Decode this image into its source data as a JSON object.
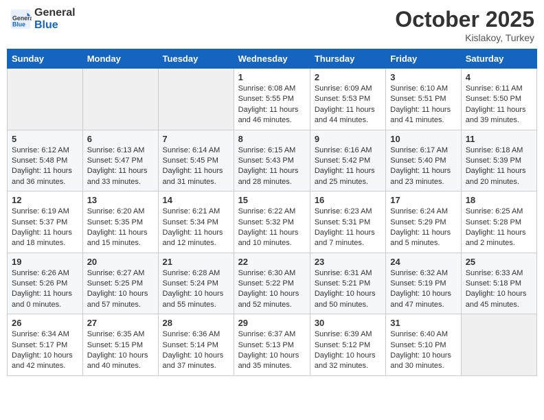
{
  "header": {
    "logo_line1": "General",
    "logo_line2": "Blue",
    "month": "October 2025",
    "location": "Kislakoy, Turkey"
  },
  "days_of_week": [
    "Sunday",
    "Monday",
    "Tuesday",
    "Wednesday",
    "Thursday",
    "Friday",
    "Saturday"
  ],
  "weeks": [
    [
      {
        "day": "",
        "info": ""
      },
      {
        "day": "",
        "info": ""
      },
      {
        "day": "",
        "info": ""
      },
      {
        "day": "1",
        "info": "Sunrise: 6:08 AM\nSunset: 5:55 PM\nDaylight: 11 hours\nand 46 minutes."
      },
      {
        "day": "2",
        "info": "Sunrise: 6:09 AM\nSunset: 5:53 PM\nDaylight: 11 hours\nand 44 minutes."
      },
      {
        "day": "3",
        "info": "Sunrise: 6:10 AM\nSunset: 5:51 PM\nDaylight: 11 hours\nand 41 minutes."
      },
      {
        "day": "4",
        "info": "Sunrise: 6:11 AM\nSunset: 5:50 PM\nDaylight: 11 hours\nand 39 minutes."
      }
    ],
    [
      {
        "day": "5",
        "info": "Sunrise: 6:12 AM\nSunset: 5:48 PM\nDaylight: 11 hours\nand 36 minutes."
      },
      {
        "day": "6",
        "info": "Sunrise: 6:13 AM\nSunset: 5:47 PM\nDaylight: 11 hours\nand 33 minutes."
      },
      {
        "day": "7",
        "info": "Sunrise: 6:14 AM\nSunset: 5:45 PM\nDaylight: 11 hours\nand 31 minutes."
      },
      {
        "day": "8",
        "info": "Sunrise: 6:15 AM\nSunset: 5:43 PM\nDaylight: 11 hours\nand 28 minutes."
      },
      {
        "day": "9",
        "info": "Sunrise: 6:16 AM\nSunset: 5:42 PM\nDaylight: 11 hours\nand 25 minutes."
      },
      {
        "day": "10",
        "info": "Sunrise: 6:17 AM\nSunset: 5:40 PM\nDaylight: 11 hours\nand 23 minutes."
      },
      {
        "day": "11",
        "info": "Sunrise: 6:18 AM\nSunset: 5:39 PM\nDaylight: 11 hours\nand 20 minutes."
      }
    ],
    [
      {
        "day": "12",
        "info": "Sunrise: 6:19 AM\nSunset: 5:37 PM\nDaylight: 11 hours\nand 18 minutes."
      },
      {
        "day": "13",
        "info": "Sunrise: 6:20 AM\nSunset: 5:35 PM\nDaylight: 11 hours\nand 15 minutes."
      },
      {
        "day": "14",
        "info": "Sunrise: 6:21 AM\nSunset: 5:34 PM\nDaylight: 11 hours\nand 12 minutes."
      },
      {
        "day": "15",
        "info": "Sunrise: 6:22 AM\nSunset: 5:32 PM\nDaylight: 11 hours\nand 10 minutes."
      },
      {
        "day": "16",
        "info": "Sunrise: 6:23 AM\nSunset: 5:31 PM\nDaylight: 11 hours\nand 7 minutes."
      },
      {
        "day": "17",
        "info": "Sunrise: 6:24 AM\nSunset: 5:29 PM\nDaylight: 11 hours\nand 5 minutes."
      },
      {
        "day": "18",
        "info": "Sunrise: 6:25 AM\nSunset: 5:28 PM\nDaylight: 11 hours\nand 2 minutes."
      }
    ],
    [
      {
        "day": "19",
        "info": "Sunrise: 6:26 AM\nSunset: 5:26 PM\nDaylight: 11 hours\nand 0 minutes."
      },
      {
        "day": "20",
        "info": "Sunrise: 6:27 AM\nSunset: 5:25 PM\nDaylight: 10 hours\nand 57 minutes."
      },
      {
        "day": "21",
        "info": "Sunrise: 6:28 AM\nSunset: 5:24 PM\nDaylight: 10 hours\nand 55 minutes."
      },
      {
        "day": "22",
        "info": "Sunrise: 6:30 AM\nSunset: 5:22 PM\nDaylight: 10 hours\nand 52 minutes."
      },
      {
        "day": "23",
        "info": "Sunrise: 6:31 AM\nSunset: 5:21 PM\nDaylight: 10 hours\nand 50 minutes."
      },
      {
        "day": "24",
        "info": "Sunrise: 6:32 AM\nSunset: 5:19 PM\nDaylight: 10 hours\nand 47 minutes."
      },
      {
        "day": "25",
        "info": "Sunrise: 6:33 AM\nSunset: 5:18 PM\nDaylight: 10 hours\nand 45 minutes."
      }
    ],
    [
      {
        "day": "26",
        "info": "Sunrise: 6:34 AM\nSunset: 5:17 PM\nDaylight: 10 hours\nand 42 minutes."
      },
      {
        "day": "27",
        "info": "Sunrise: 6:35 AM\nSunset: 5:15 PM\nDaylight: 10 hours\nand 40 minutes."
      },
      {
        "day": "28",
        "info": "Sunrise: 6:36 AM\nSunset: 5:14 PM\nDaylight: 10 hours\nand 37 minutes."
      },
      {
        "day": "29",
        "info": "Sunrise: 6:37 AM\nSunset: 5:13 PM\nDaylight: 10 hours\nand 35 minutes."
      },
      {
        "day": "30",
        "info": "Sunrise: 6:39 AM\nSunset: 5:12 PM\nDaylight: 10 hours\nand 32 minutes."
      },
      {
        "day": "31",
        "info": "Sunrise: 6:40 AM\nSunset: 5:10 PM\nDaylight: 10 hours\nand 30 minutes."
      },
      {
        "day": "",
        "info": ""
      }
    ]
  ]
}
